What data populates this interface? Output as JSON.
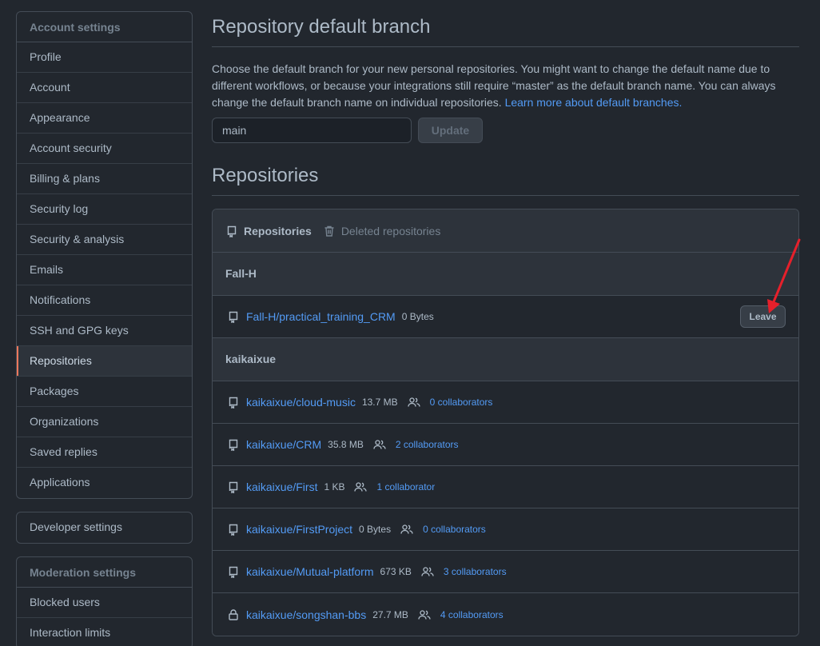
{
  "sidebar": {
    "account_heading": "Account settings",
    "items": [
      {
        "label": "Profile",
        "selected": false
      },
      {
        "label": "Account",
        "selected": false
      },
      {
        "label": "Appearance",
        "selected": false
      },
      {
        "label": "Account security",
        "selected": false
      },
      {
        "label": "Billing & plans",
        "selected": false
      },
      {
        "label": "Security log",
        "selected": false
      },
      {
        "label": "Security & analysis",
        "selected": false
      },
      {
        "label": "Emails",
        "selected": false
      },
      {
        "label": "Notifications",
        "selected": false
      },
      {
        "label": "SSH and GPG keys",
        "selected": false
      },
      {
        "label": "Repositories",
        "selected": true
      },
      {
        "label": "Packages",
        "selected": false
      },
      {
        "label": "Organizations",
        "selected": false
      },
      {
        "label": "Saved replies",
        "selected": false
      },
      {
        "label": "Applications",
        "selected": false
      }
    ],
    "developer_settings": "Developer settings",
    "moderation_heading": "Moderation settings",
    "moderation_items": [
      {
        "label": "Blocked users"
      },
      {
        "label": "Interaction limits"
      }
    ]
  },
  "default_branch": {
    "title": "Repository default branch",
    "description": "Choose the default branch for your new personal repositories. You might want to change the default name due to different workflows, or because your integrations still require “master” as the default branch name. You can always change the default branch name on individual repositories.",
    "learn_more": "Learn more about default branches.",
    "input_value": "main",
    "update_label": "Update"
  },
  "repositories": {
    "title": "Repositories",
    "tabs": {
      "active": "Repositories",
      "deleted": "Deleted repositories"
    },
    "groups": [
      {
        "owner": "Fall-H",
        "repos": [
          {
            "name": "Fall-H/practical_training_CRM",
            "size": "0 Bytes",
            "collaborators": "",
            "leave_label": "Leave",
            "private": false
          }
        ]
      },
      {
        "owner": "kaikaixue",
        "repos": [
          {
            "name": "kaikaixue/cloud-music",
            "size": "13.7 MB",
            "collaborators": "0 collaborators",
            "private": false
          },
          {
            "name": "kaikaixue/CRM",
            "size": "35.8 MB",
            "collaborators": "2 collaborators",
            "private": false
          },
          {
            "name": "kaikaixue/First",
            "size": "1 KB",
            "collaborators": "1 collaborator",
            "private": false
          },
          {
            "name": "kaikaixue/FirstProject",
            "size": "0 Bytes",
            "collaborators": "0 collaborators",
            "private": false
          },
          {
            "name": "kaikaixue/Mutual-platform",
            "size": "673 KB",
            "collaborators": "3 collaborators",
            "private": false
          },
          {
            "name": "kaikaixue/songshan-bbs",
            "size": "27.7 MB",
            "collaborators": "4 collaborators",
            "private": true
          }
        ]
      }
    ]
  },
  "colors": {
    "background": "#22272e",
    "link": "#539bf5",
    "accent_selected": "#ec775c",
    "annotation_arrow": "#e5202b"
  }
}
